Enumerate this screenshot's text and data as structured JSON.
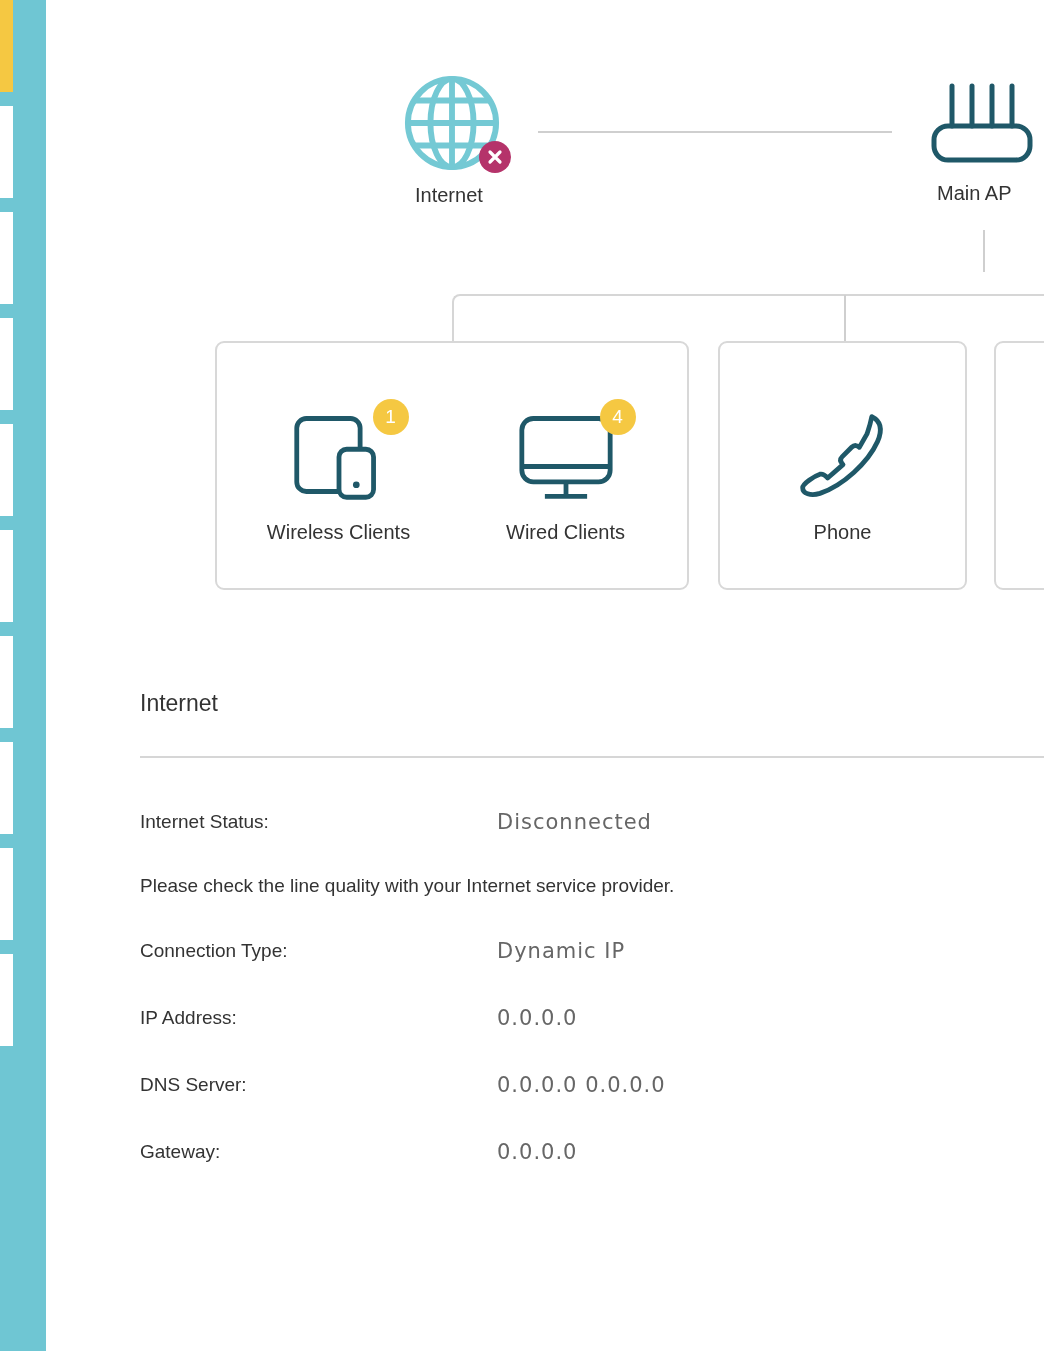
{
  "sidebar": {
    "items": [
      {
        "selected": true
      },
      {
        "selected": false
      },
      {
        "selected": false
      },
      {
        "selected": false
      },
      {
        "selected": false
      },
      {
        "selected": false
      },
      {
        "selected": false
      },
      {
        "selected": false
      },
      {
        "selected": false
      },
      {
        "selected": false
      }
    ]
  },
  "topology": {
    "internet": {
      "label": "Internet",
      "connected": false
    },
    "main_ap": {
      "label": "Main AP"
    },
    "cards": [
      {
        "clients": [
          {
            "kind": "wireless",
            "label": "Wireless Clients",
            "count": "1"
          },
          {
            "kind": "wired",
            "label": "Wired Clients",
            "count": "4"
          }
        ]
      },
      {
        "clients": [
          {
            "kind": "phone",
            "label": "Phone"
          }
        ]
      }
    ]
  },
  "details": {
    "title": "Internet",
    "rows": [
      {
        "kind": "field",
        "label": "Internet Status:",
        "value": "Disconnected"
      },
      {
        "kind": "note",
        "text": "Please check the line quality with your Internet service provider."
      },
      {
        "kind": "field",
        "label": "Connection Type:",
        "value": "Dynamic IP"
      },
      {
        "kind": "field",
        "label": "IP Address:",
        "value": "0.0.0.0"
      },
      {
        "kind": "field",
        "label": "DNS Server:",
        "value": "0.0.0.0 0.0.0.0"
      },
      {
        "kind": "field",
        "label": "Gateway:",
        "value": "0.0.0.0"
      }
    ]
  }
}
